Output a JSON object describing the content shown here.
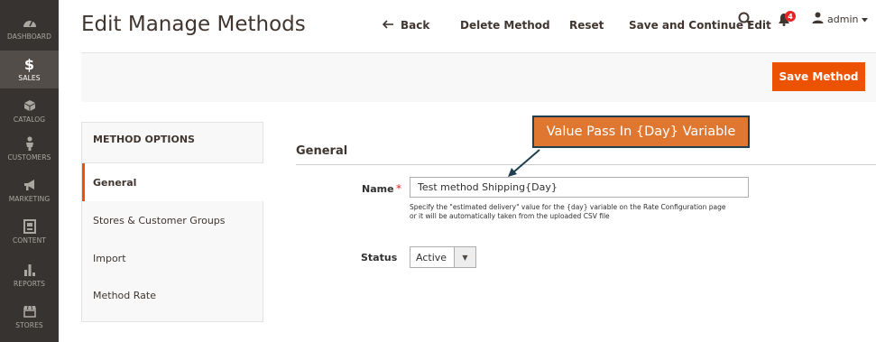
{
  "sidebar": {
    "items": [
      {
        "label": "DASHBOARD",
        "icon": "dashboard-icon"
      },
      {
        "label": "SALES",
        "icon": "dollar-icon"
      },
      {
        "label": "CATALOG",
        "icon": "cube-icon"
      },
      {
        "label": "CUSTOMERS",
        "icon": "person-icon"
      },
      {
        "label": "MARKETING",
        "icon": "megaphone-icon"
      },
      {
        "label": "CONTENT",
        "icon": "content-icon"
      },
      {
        "label": "REPORTS",
        "icon": "bar-chart-icon"
      },
      {
        "label": "STORES",
        "icon": "store-icon"
      }
    ],
    "sales_glyph": "$"
  },
  "header": {
    "title": "Edit Manage Methods",
    "notification_count": "4",
    "user": "admin"
  },
  "actions": {
    "back": "Back",
    "delete": "Delete Method",
    "reset": "Reset",
    "save_continue": "Save and Continue Edit",
    "save": "Save Method"
  },
  "tabs": {
    "title": "METHOD OPTIONS",
    "items": [
      "General",
      "Stores & Customer Groups",
      "Import",
      "Method Rate"
    ]
  },
  "form": {
    "section_title": "General",
    "name_label": "Name",
    "name_value": "Test method Shipping{Day}",
    "name_note_line1": "Specify the \"estimated delivery\" value for the {day} variable on the Rate Configuration page",
    "name_note_line2": "or it will be automatically taken from the uploaded CSV file",
    "status_label": "Status",
    "status_value": "Active"
  },
  "callout": {
    "text": "Value Pass In {Day} Variable"
  },
  "colors": {
    "sidebar_bg": "#373330",
    "accent": "#eb5202",
    "callout_bg": "#e07730",
    "callout_border": "#1f3f50"
  }
}
